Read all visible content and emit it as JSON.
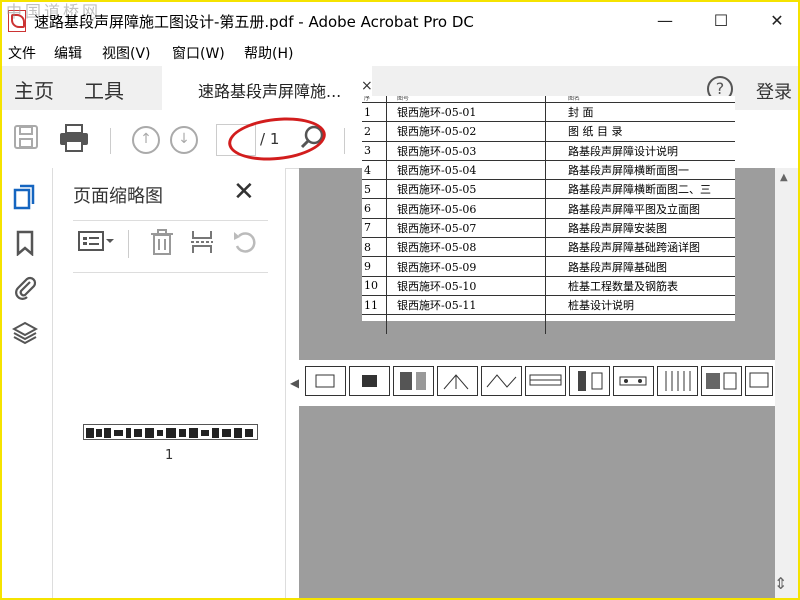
{
  "window": {
    "title": "速路基段声屏障施工图设计-第五册.pdf - Adobe Acrobat Pro DC",
    "watermark": "中国道桥网",
    "minimize": "—",
    "maximize": "☐",
    "close": "✕"
  },
  "menu": [
    "文件",
    "编辑",
    "视图(V)",
    "窗口(W)",
    "帮助(H)"
  ],
  "tabs": {
    "home": "主页",
    "tools": "工具",
    "document": "速路基段声屏障施...",
    "close": "×",
    "help": "?",
    "login": "登录"
  },
  "toolbar": {
    "current_page": "",
    "page_total": "/ 1"
  },
  "thumbnail_panel": {
    "title": "页面缩略图",
    "close": "✕",
    "page_label": "1"
  },
  "document": {
    "header": [
      "序",
      "图号",
      "图名"
    ],
    "rows": [
      {
        "no": "1",
        "code": "银西施环-05-01",
        "name": "封  面"
      },
      {
        "no": "2",
        "code": "银西施环-05-02",
        "name": "图 纸 目 录"
      },
      {
        "no": "3",
        "code": "银西施环-05-03",
        "name": "路基段声屏障设计说明"
      },
      {
        "no": "4",
        "code": "银西施环-05-04",
        "name": "路基段声屏障横断面图一"
      },
      {
        "no": "5",
        "code": "银西施环-05-05",
        "name": "路基段声屏障横断面图二、三"
      },
      {
        "no": "6",
        "code": "银西施环-05-06",
        "name": "路基段声屏障平图及立面图"
      },
      {
        "no": "7",
        "code": "银西施环-05-07",
        "name": "路基段声屏障安装图"
      },
      {
        "no": "8",
        "code": "银西施环-05-08",
        "name": "路基段声屏障基础跨涵详图"
      },
      {
        "no": "9",
        "code": "银西施环-05-09",
        "name": "路基段声屏障基础图"
      },
      {
        "no": "10",
        "code": "银西施环-05-10",
        "name": "桩基工程数量及钢筋表"
      },
      {
        "no": "11",
        "code": "银西施环-05-11",
        "name": "桩基设计说明"
      }
    ]
  },
  "colors": {
    "frame": "#f5e300",
    "annotation": "#d21d1d",
    "doc_background": "#9d9d9d"
  }
}
